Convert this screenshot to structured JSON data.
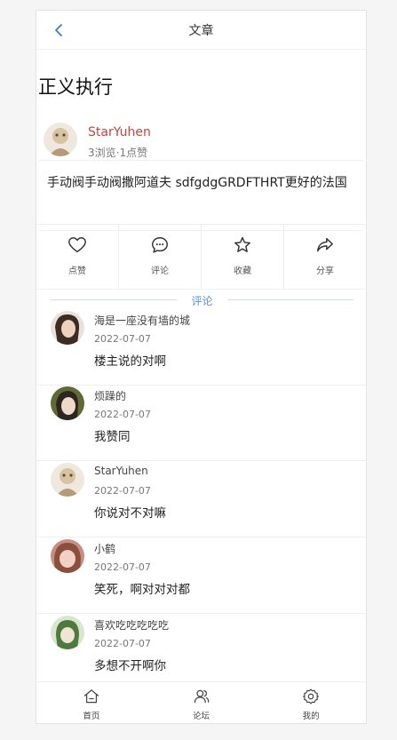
{
  "header": {
    "title": "文章"
  },
  "article": {
    "title": "正义执行",
    "author": "StarYuhen",
    "meta": "3浏览·1点赞",
    "content": "手动阀手动阀撒阿道夫 sdfgdgGRDFTHRT更好的法国"
  },
  "actions": [
    {
      "label": "点赞",
      "icon": "heart-icon"
    },
    {
      "label": "评论",
      "icon": "comment-icon"
    },
    {
      "label": "收藏",
      "icon": "star-icon"
    },
    {
      "label": "分享",
      "icon": "share-icon"
    }
  ],
  "comments_section": {
    "divider_label": "评论"
  },
  "comments": [
    {
      "name": "海是一座没有墙的城",
      "date": "2022-07-07",
      "text": "楼主说的对啊",
      "avatar_color": "#b08a6e"
    },
    {
      "name": "烦躁的",
      "date": "2022-07-07",
      "text": "我赞同",
      "avatar_color": "#6e7a3f"
    },
    {
      "name": "StarYuhen",
      "date": "2022-07-07",
      "text": "你说对不对嘛",
      "avatar_color": "#c7b08a"
    },
    {
      "name": "小鹤",
      "date": "2022-07-07",
      "text": "笑死，啊对对对都",
      "avatar_color": "#d98a7a"
    },
    {
      "name": "喜欢吃吃吃吃吃",
      "date": "2022-07-07",
      "text": "多想不开啊你",
      "avatar_color": "#7aa06a"
    }
  ],
  "tabbar": [
    {
      "label": "首页",
      "icon": "home-icon"
    },
    {
      "label": "论坛",
      "icon": "users-icon"
    },
    {
      "label": "我的",
      "icon": "settings-icon"
    }
  ],
  "colors": {
    "accent": "#5a8ef0",
    "author_name": "#c9413b"
  }
}
